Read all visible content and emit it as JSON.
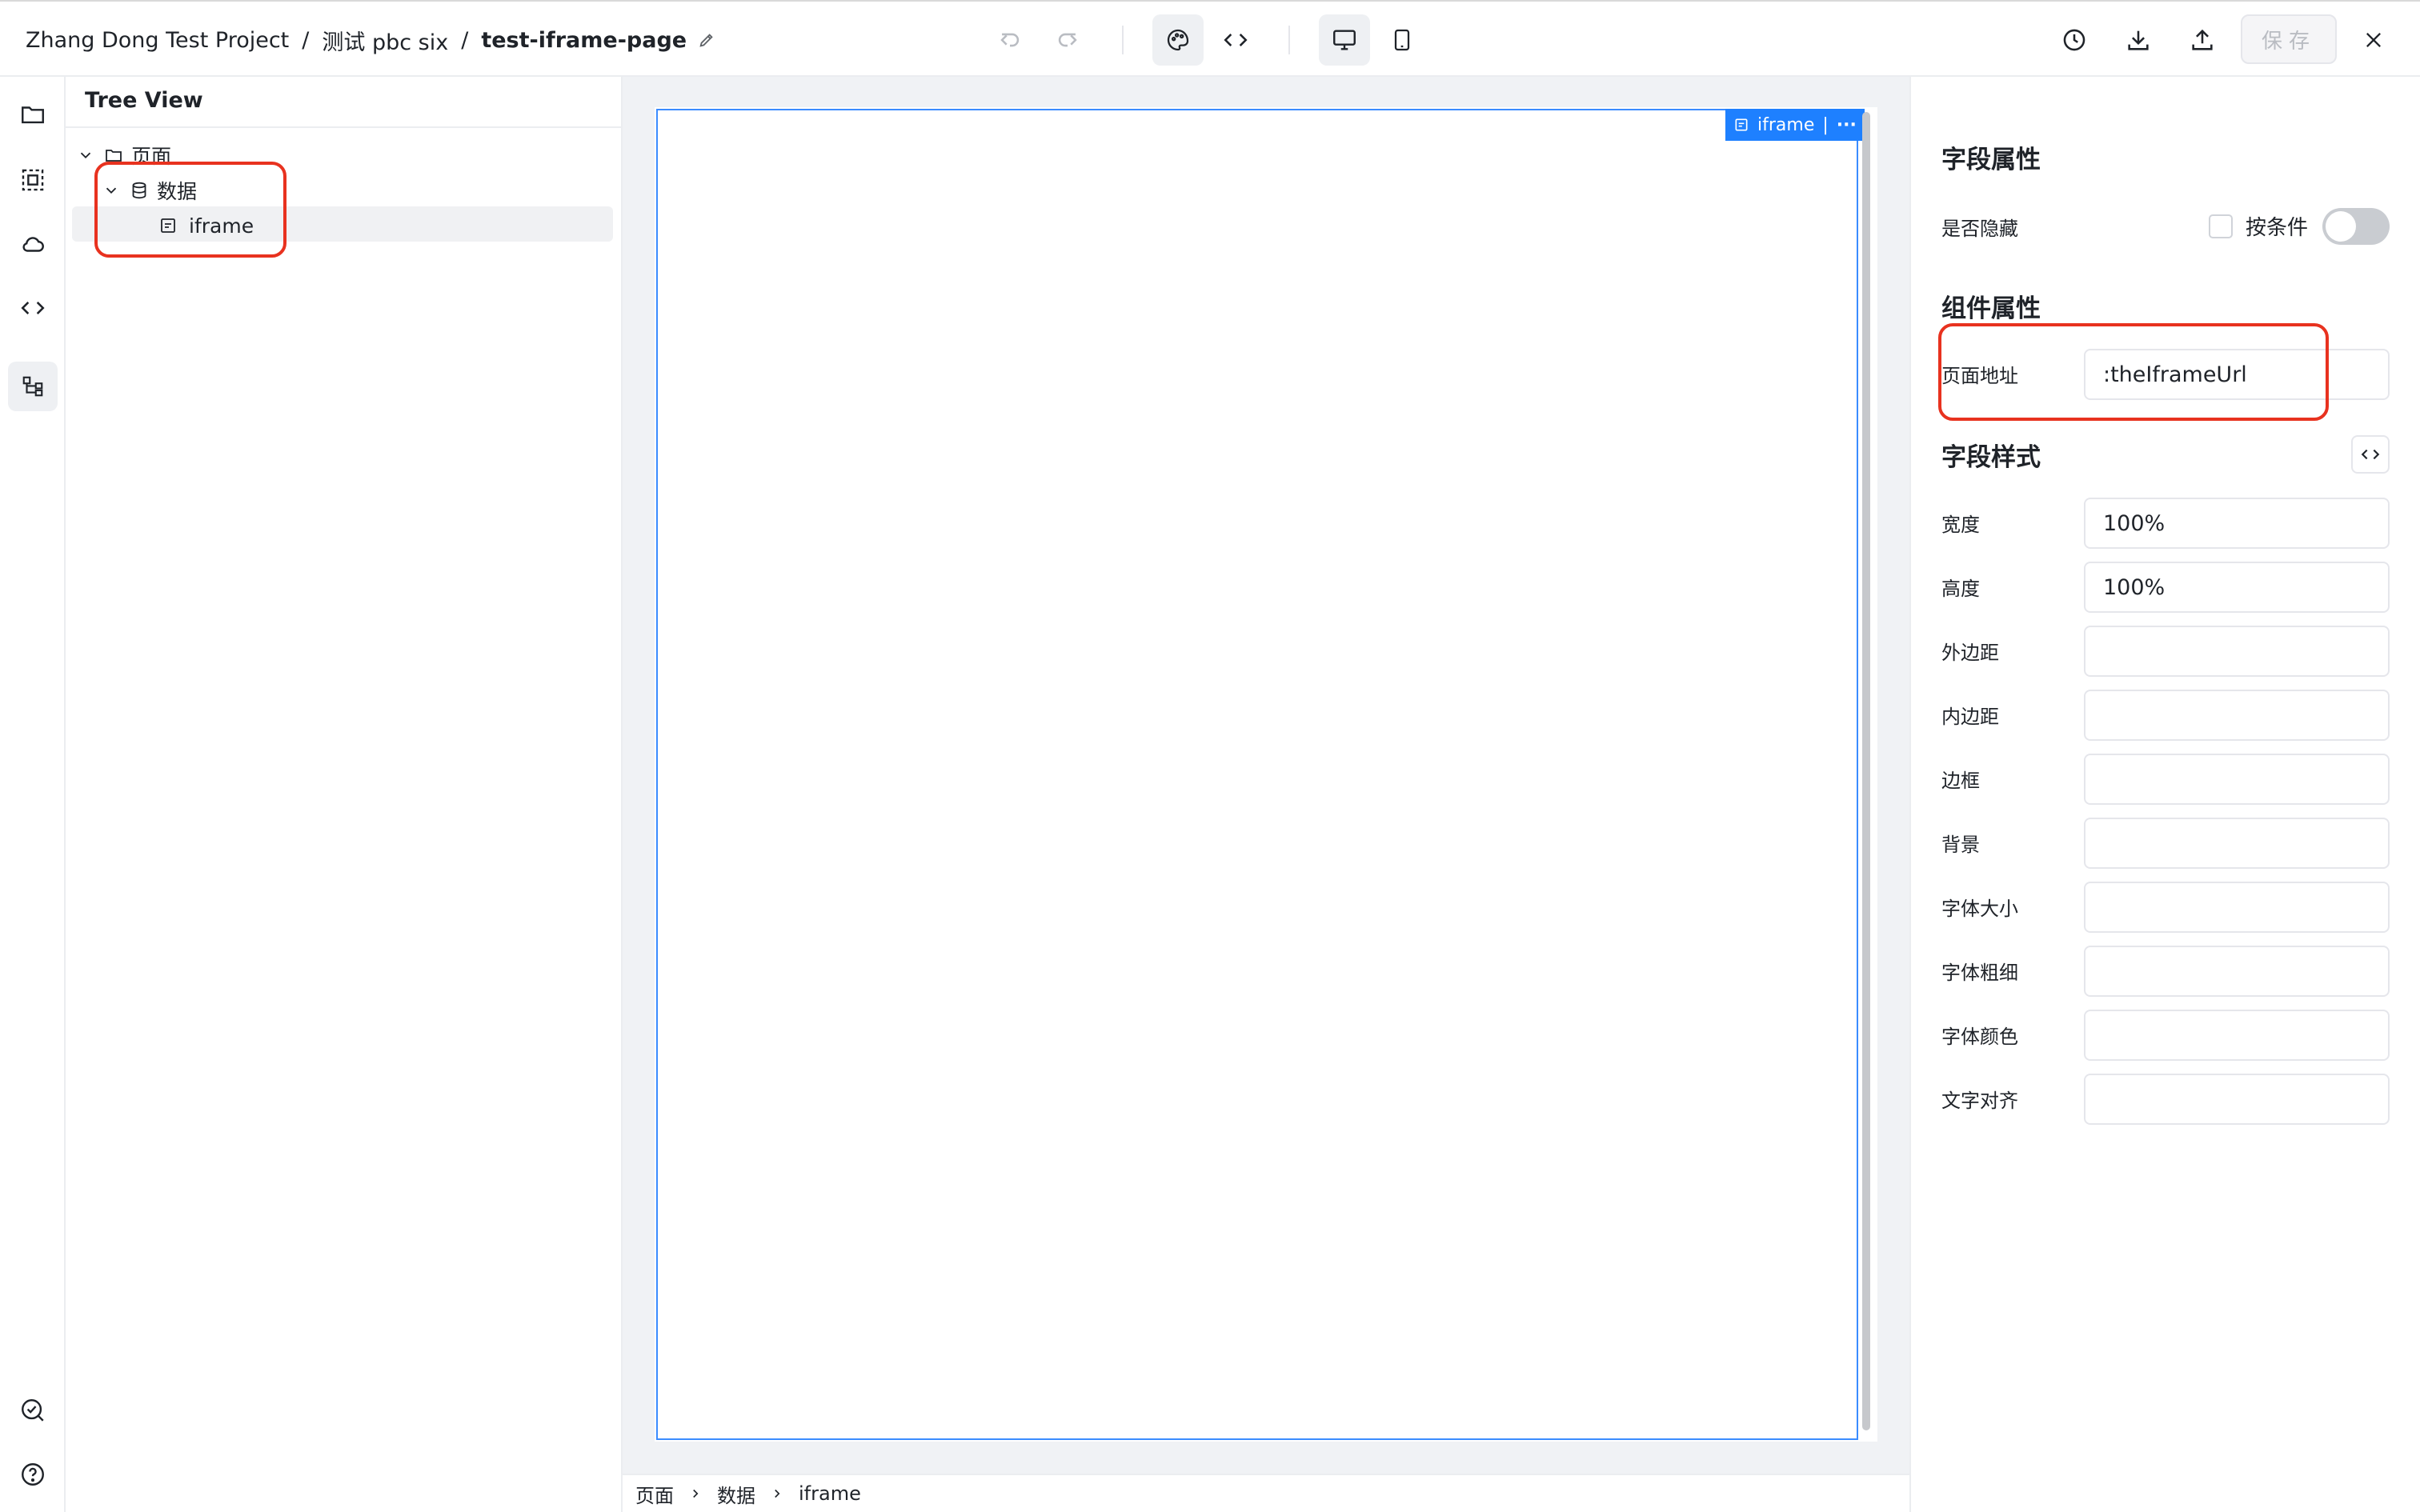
{
  "header": {
    "breadcrumb": {
      "project": "Zhang Dong Test Project",
      "separator": "/",
      "app": "测试 pbc six",
      "page": "test-iframe-page"
    },
    "save_label": "保存",
    "icons": [
      "undo-icon",
      "redo-icon",
      "palette-icon",
      "code-icon",
      "desktop-icon",
      "tablet-icon",
      "history-icon",
      "download-icon",
      "upload-icon",
      "close-icon"
    ]
  },
  "rail": {
    "icons": [
      "folder-icon",
      "selection-icon",
      "cloud-icon",
      "code-icon",
      "tree-structure-icon",
      "check-search-icon",
      "help-icon"
    ]
  },
  "tree": {
    "title": "Tree View",
    "nodes": [
      {
        "label": "页面",
        "icon": "folder-icon"
      },
      {
        "label": "数据",
        "icon": "database-icon"
      },
      {
        "label": "iframe",
        "icon": "form-icon"
      }
    ]
  },
  "canvas": {
    "tag_label": "iframe",
    "tag_divider": "|",
    "tag_more": "···"
  },
  "status_breadcrumb": [
    "页面",
    "数据",
    "iframe"
  ],
  "props": {
    "field_props_title": "字段属性",
    "hidden_label": "是否隐藏",
    "by_condition_label": "按条件",
    "by_condition_checked": false,
    "hidden_toggle_on": false,
    "component_props_title": "组件属性",
    "page_url_label": "页面地址",
    "page_url_value": ":theIframeUrl",
    "field_style_title": "字段样式",
    "styles": [
      {
        "label": "宽度",
        "value": "100%"
      },
      {
        "label": "高度",
        "value": "100%"
      },
      {
        "label": "外边距",
        "value": ""
      },
      {
        "label": "内边距",
        "value": ""
      },
      {
        "label": "边框",
        "value": ""
      },
      {
        "label": "背景",
        "value": ""
      },
      {
        "label": "字体大小",
        "value": ""
      },
      {
        "label": "字体粗细",
        "value": ""
      },
      {
        "label": "字体颜色",
        "value": ""
      },
      {
        "label": "文字对齐",
        "value": ""
      }
    ]
  },
  "colors": {
    "accent": "#1e80ff",
    "annotation_red": "#e8321f"
  }
}
